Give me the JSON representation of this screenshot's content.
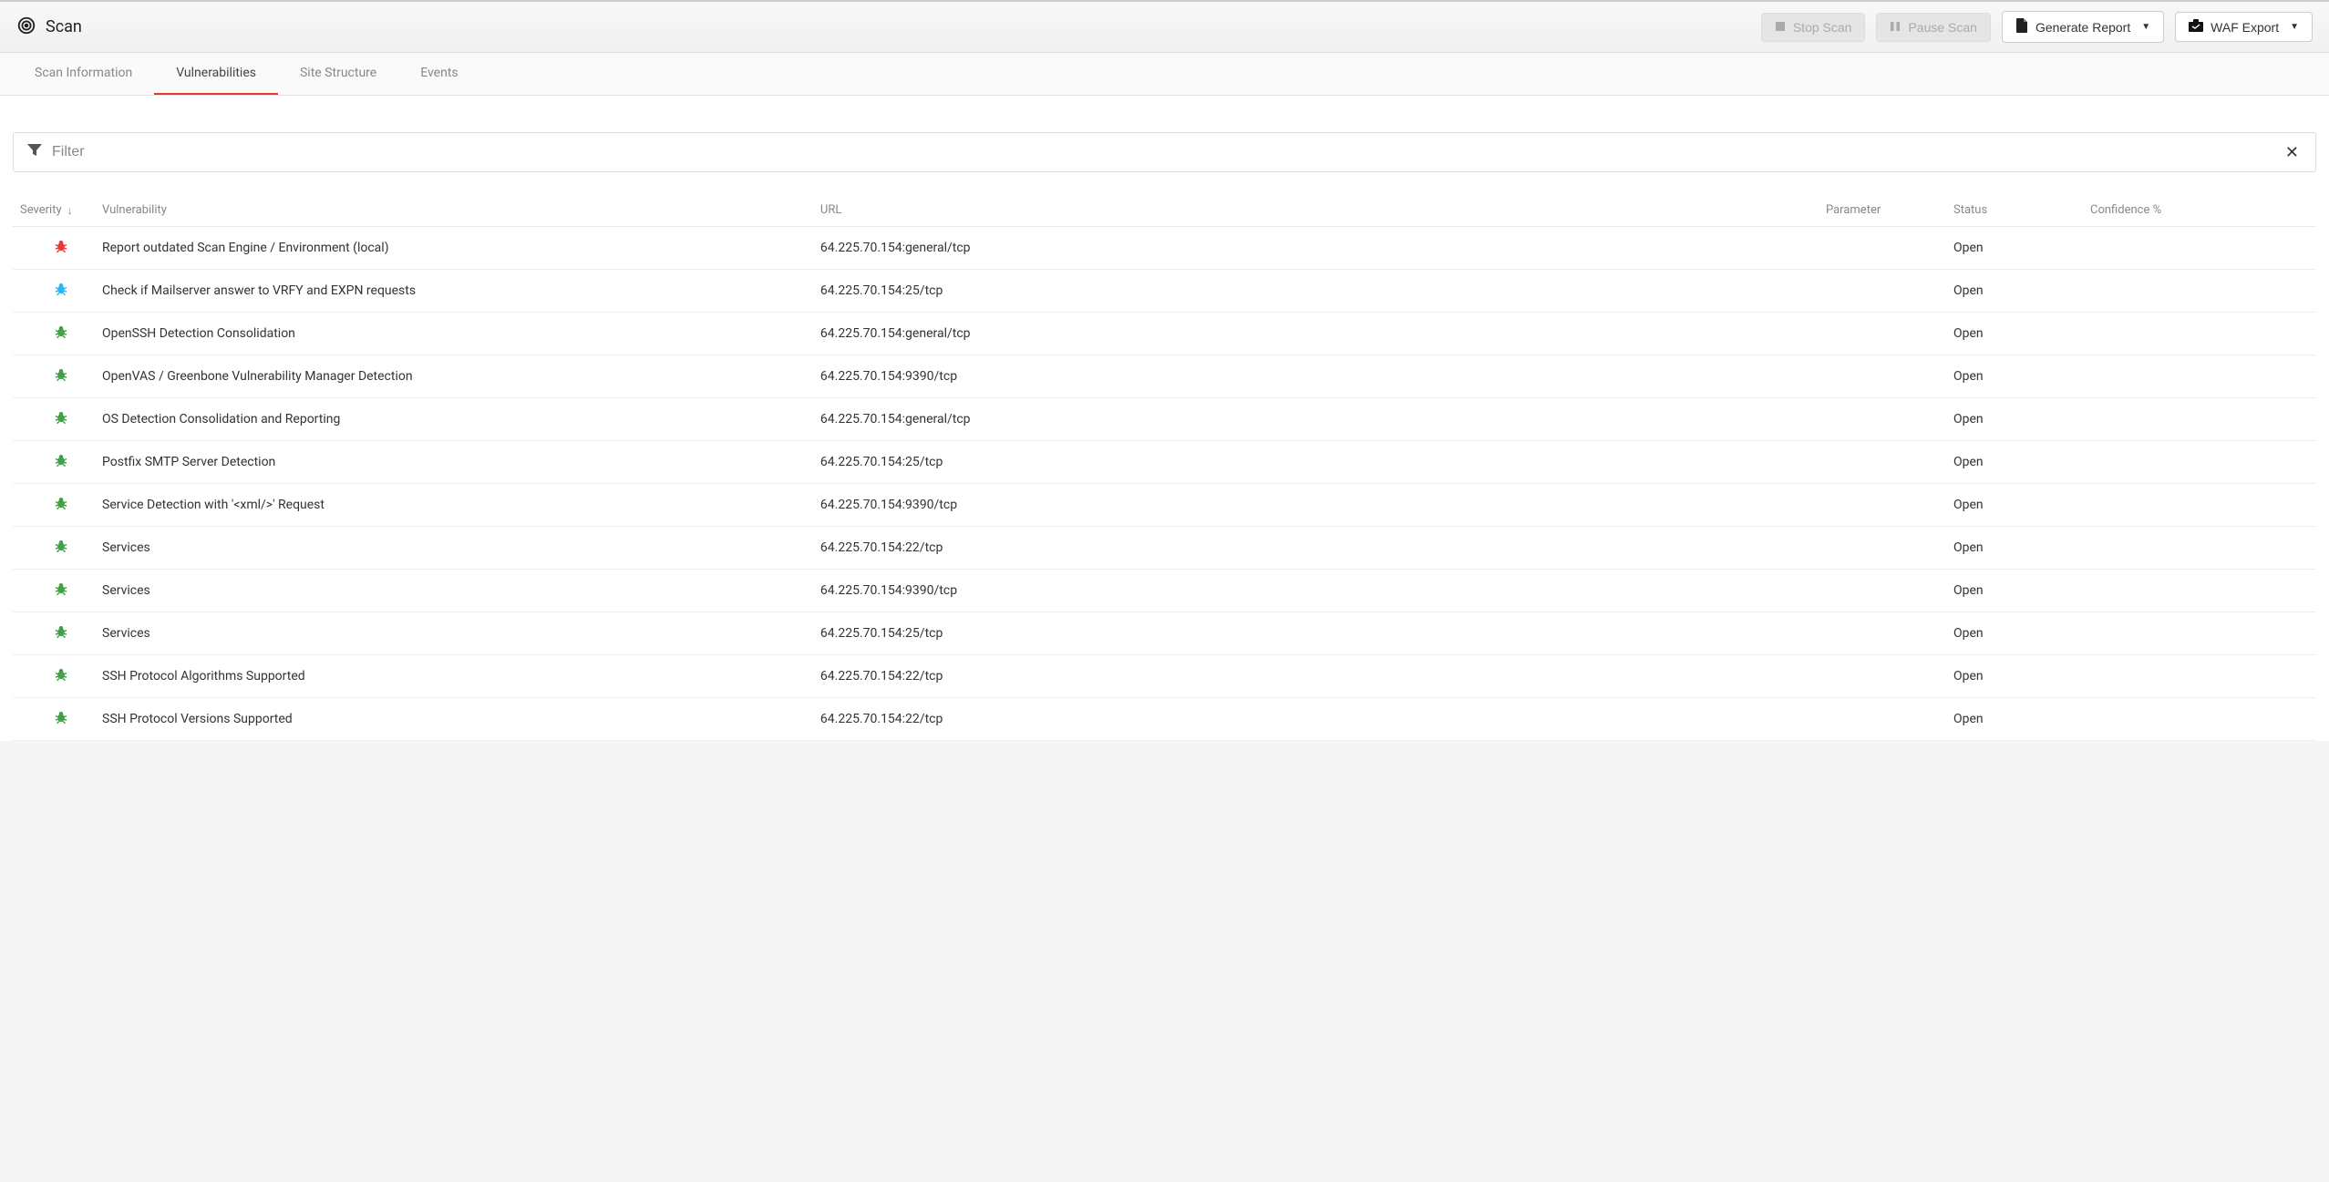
{
  "header": {
    "title": "Scan",
    "stop_label": "Stop Scan",
    "pause_label": "Pause Scan",
    "report_label": "Generate Report",
    "waf_label": "WAF Export"
  },
  "tabs": [
    {
      "label": "Scan Information",
      "active": false
    },
    {
      "label": "Vulnerabilities",
      "active": true
    },
    {
      "label": "Site Structure",
      "active": false
    },
    {
      "label": "Events",
      "active": false
    }
  ],
  "filter": {
    "placeholder": "Filter"
  },
  "columns": {
    "severity": "Severity",
    "vulnerability": "Vulnerability",
    "url": "URL",
    "parameter": "Parameter",
    "status": "Status",
    "confidence": "Confidence %"
  },
  "severity_colors": {
    "high": "#e53935",
    "medium": "#29b6f6",
    "info": "#43a047"
  },
  "rows": [
    {
      "severity": "high",
      "vulnerability": "Report outdated Scan Engine / Environment (local)",
      "url": "64.225.70.154:general/tcp",
      "parameter": "",
      "status": "Open",
      "confidence": ""
    },
    {
      "severity": "medium",
      "vulnerability": "Check if Mailserver answer to VRFY and EXPN requests",
      "url": "64.225.70.154:25/tcp",
      "parameter": "",
      "status": "Open",
      "confidence": ""
    },
    {
      "severity": "info",
      "vulnerability": "OpenSSH Detection Consolidation",
      "url": "64.225.70.154:general/tcp",
      "parameter": "",
      "status": "Open",
      "confidence": ""
    },
    {
      "severity": "info",
      "vulnerability": "OpenVAS / Greenbone Vulnerability Manager Detection",
      "url": "64.225.70.154:9390/tcp",
      "parameter": "",
      "status": "Open",
      "confidence": ""
    },
    {
      "severity": "info",
      "vulnerability": "OS Detection Consolidation and Reporting",
      "url": "64.225.70.154:general/tcp",
      "parameter": "",
      "status": "Open",
      "confidence": ""
    },
    {
      "severity": "info",
      "vulnerability": "Postfix SMTP Server Detection",
      "url": "64.225.70.154:25/tcp",
      "parameter": "",
      "status": "Open",
      "confidence": ""
    },
    {
      "severity": "info",
      "vulnerability": "Service Detection with '<xml/>' Request",
      "url": "64.225.70.154:9390/tcp",
      "parameter": "",
      "status": "Open",
      "confidence": ""
    },
    {
      "severity": "info",
      "vulnerability": "Services",
      "url": "64.225.70.154:22/tcp",
      "parameter": "",
      "status": "Open",
      "confidence": ""
    },
    {
      "severity": "info",
      "vulnerability": "Services",
      "url": "64.225.70.154:9390/tcp",
      "parameter": "",
      "status": "Open",
      "confidence": ""
    },
    {
      "severity": "info",
      "vulnerability": "Services",
      "url": "64.225.70.154:25/tcp",
      "parameter": "",
      "status": "Open",
      "confidence": ""
    },
    {
      "severity": "info",
      "vulnerability": "SSH Protocol Algorithms Supported",
      "url": "64.225.70.154:22/tcp",
      "parameter": "",
      "status": "Open",
      "confidence": ""
    },
    {
      "severity": "info",
      "vulnerability": "SSH Protocol Versions Supported",
      "url": "64.225.70.154:22/tcp",
      "parameter": "",
      "status": "Open",
      "confidence": ""
    }
  ]
}
